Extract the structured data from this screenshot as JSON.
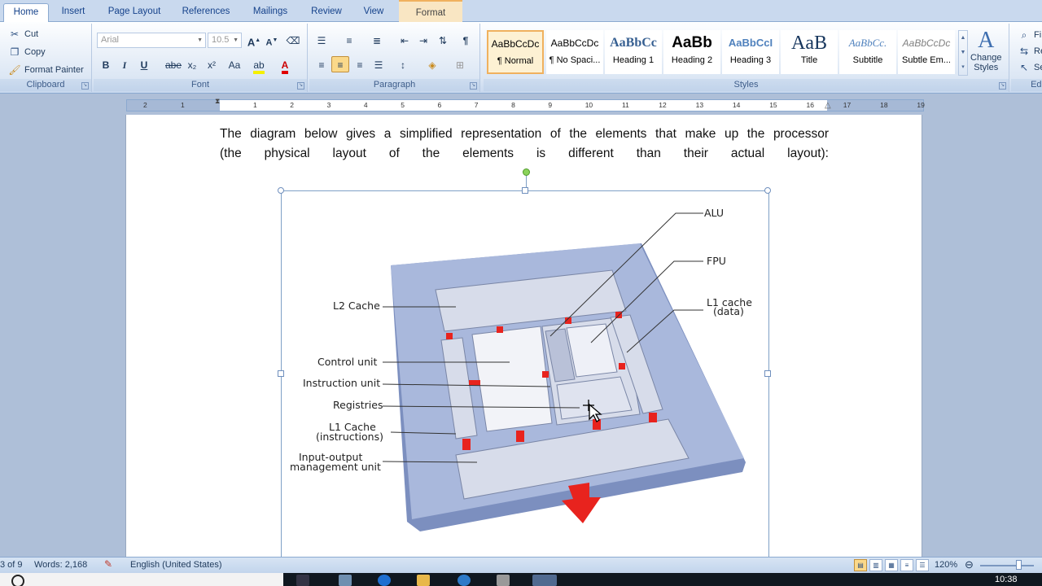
{
  "tabs": [
    "Home",
    "Insert",
    "Page Layout",
    "References",
    "Mailings",
    "Review",
    "View",
    "Format"
  ],
  "clipboard": {
    "cut": "Cut",
    "copy": "Copy",
    "format_painter": "Format Painter",
    "label": "Clipboard"
  },
  "font": {
    "name": "Arial",
    "size": "10.5",
    "label": "Font",
    "bold": "B",
    "italic": "I",
    "underline": "U",
    "strike": "abe",
    "subscript": "x₂",
    "superscript": "x²",
    "change_case": "Aa",
    "grow": "A",
    "shrink": "A"
  },
  "paragraph": {
    "label": "Paragraph",
    "pilcrow": "¶"
  },
  "styles": {
    "label": "Styles",
    "items": [
      {
        "sample": "AaBbCcDc",
        "name": "¶ Normal"
      },
      {
        "sample": "AaBbCcDc",
        "name": "¶ No Spaci..."
      },
      {
        "sample": "AaBbCc",
        "name": "Heading 1"
      },
      {
        "sample": "AaBb",
        "name": "Heading 2"
      },
      {
        "sample": "AaBbCcI",
        "name": "Heading 3"
      },
      {
        "sample": "AaB",
        "name": "Title"
      },
      {
        "sample": "AaBbCc.",
        "name": "Subtitle"
      },
      {
        "sample": "AaBbCcDc",
        "name": "Subtle Em..."
      }
    ],
    "change_styles_1": "Change",
    "change_styles_2": "Styles"
  },
  "editing": {
    "find": "Fi",
    "replace": "Re",
    "select": "Se",
    "label": "Edi"
  },
  "ruler": {
    "left_ticks": [
      "2",
      "1"
    ],
    "right_ticks": [
      "1",
      "2",
      "3",
      "4",
      "5",
      "6",
      "7",
      "8",
      "9",
      "10",
      "11",
      "12",
      "13",
      "14",
      "15",
      "16",
      "17",
      "18",
      "19"
    ]
  },
  "document": {
    "paragraph_line1": "The diagram below gives a simplified representation of the elements that make up the processor",
    "paragraph_line2": "(the physical layout of the elements is different than their actual layout):"
  },
  "diagram": {
    "labels": {
      "alu": "ALU",
      "fpu": "FPU",
      "l1_data_1": "L1 cache",
      "l1_data_2": "(data)",
      "l2": "L2 Cache",
      "control": "Control unit",
      "instruction": "Instruction unit",
      "registries": "Registries",
      "l1_instr_1": "L1 Cache",
      "l1_instr_2": "(instructions)",
      "io_1": "Input-output",
      "io_2": "management unit"
    },
    "colors": {
      "board": "#a9b8dc",
      "unit": "#d7dcea",
      "connector": "#e8231e"
    }
  },
  "status": {
    "page": "3 of 9",
    "words": "Words: 2,168",
    "language": "English (United States)",
    "zoom": "120%"
  },
  "taskbar": {
    "time": "10:38"
  }
}
